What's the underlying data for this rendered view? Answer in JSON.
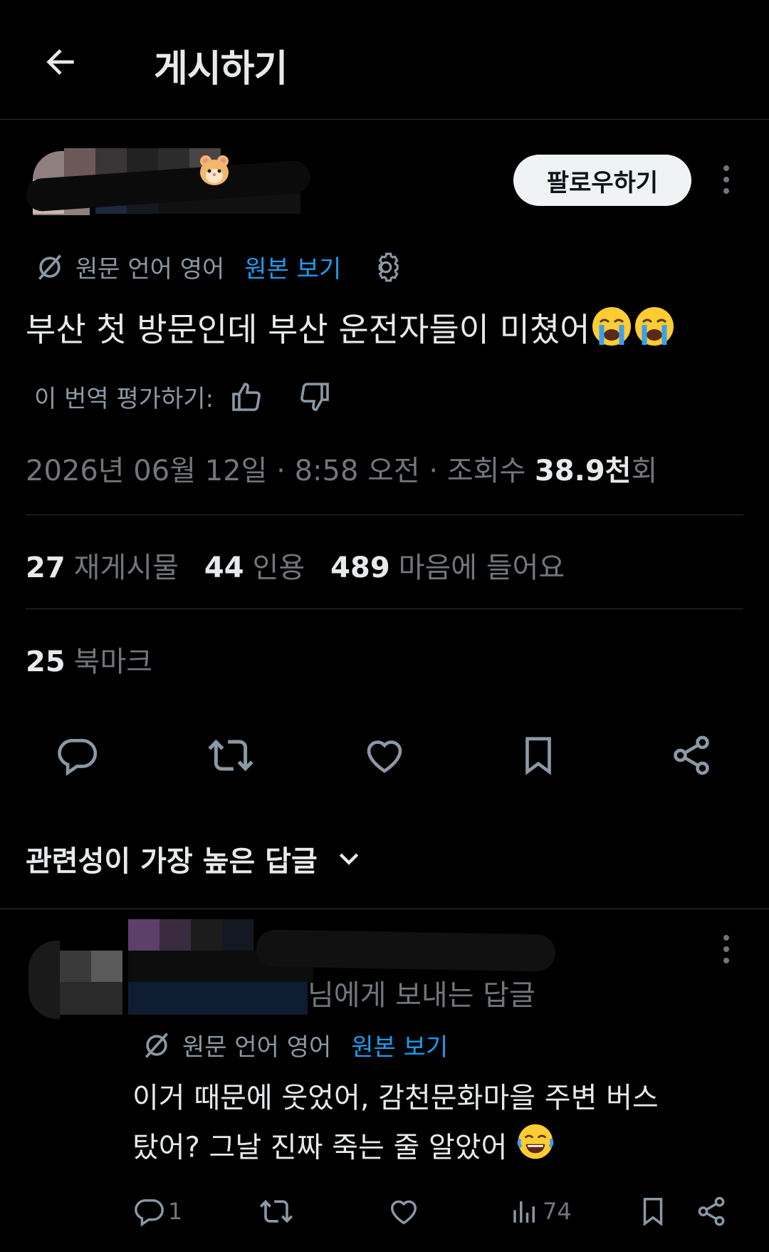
{
  "header": {
    "title": "게시하기"
  },
  "post": {
    "follow_label": "팔로우하기",
    "translate": {
      "source_label": "원문 언어 영어",
      "view_original": "원본 보기"
    },
    "text": "부산 첫 방문인데 부산 운전자들이 미쳤어",
    "rate_label": "이 번역 평가하기:",
    "meta": {
      "datetime": "2026년 06월 12일 · 8:58 오전 · 조회수 ",
      "views": "38.9천",
      "views_suffix": "회"
    },
    "stats": {
      "reposts": "27",
      "reposts_label": "재게시물",
      "quotes": "44",
      "quotes_label": "인용",
      "likes": "489",
      "likes_label": "마음에 들어요"
    },
    "bookmarks": {
      "count": "25",
      "label": "북마크"
    }
  },
  "replies_sort": {
    "label": "관련성이 가장 높은 답글"
  },
  "reply": {
    "reply_to": "님에게 보내는 답글",
    "translate": {
      "source_label": "원문 언어 영어",
      "view_original": "원본 보기"
    },
    "text_line1": "이거 때문에 웃었어, 감천문화마을 주변 버스",
    "text_line2": "탔어? 그날 진짜 죽는 줄 알았어",
    "reply_count": "1",
    "views": "74"
  },
  "colors": {
    "accent": "#1d9bf0",
    "muted": "#71767b",
    "text": "#e7e9ea",
    "background": "#000000",
    "divider": "#2f3336"
  },
  "icons": {
    "back": "arrow-left-icon",
    "translate": "translate-off-icon",
    "settings": "gear-icon",
    "like_rate": "thumbs-up-icon",
    "dislike_rate": "thumbs-down-icon",
    "reply": "reply-icon",
    "repost": "repost-icon",
    "like": "heart-icon",
    "bookmark": "bookmark-icon",
    "share": "share-icon",
    "views": "views-icon",
    "chevron": "chevron-down-icon",
    "more": "more-icon",
    "emoji_post": "loudly-crying-face-emoji",
    "emoji_reply": "tears-of-joy-emoji",
    "emoji_name": "hamster-face-emoji"
  }
}
